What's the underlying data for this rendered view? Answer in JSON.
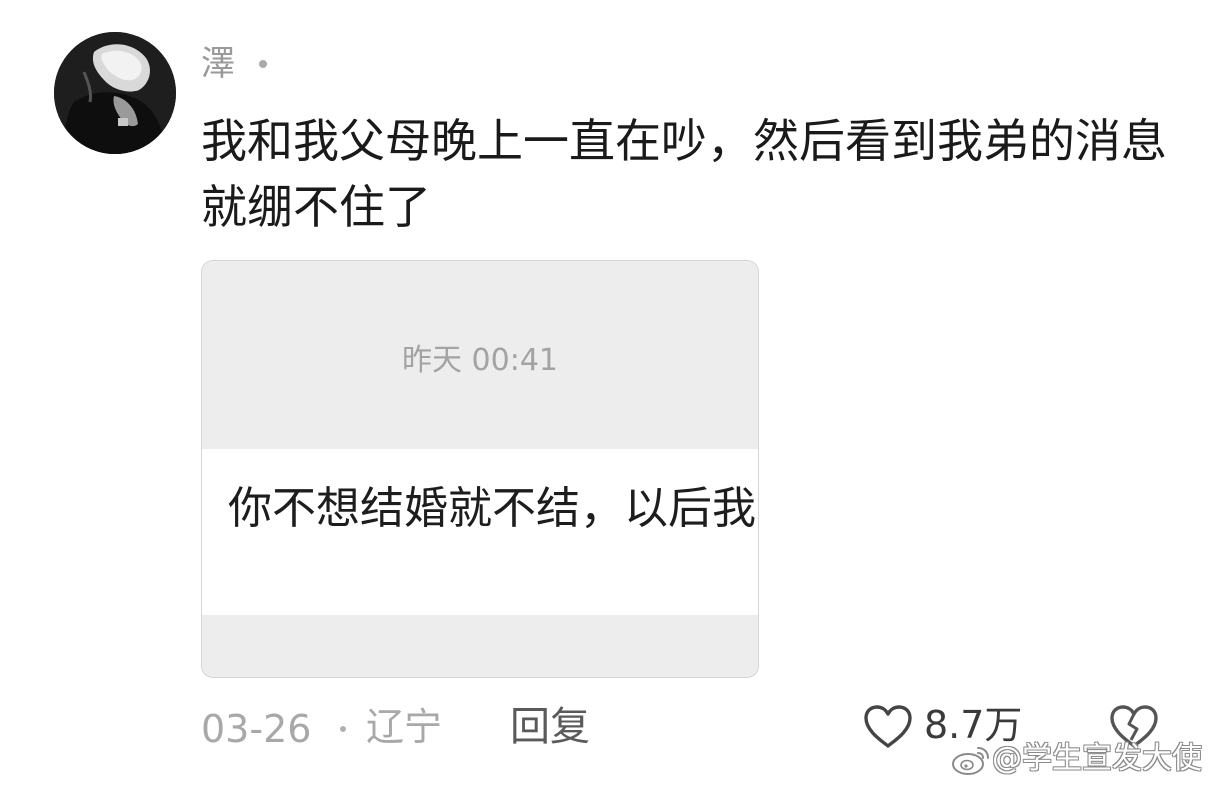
{
  "comment": {
    "username": "澤",
    "text": "我和我父母晚上一直在吵，然后看到我弟的消息就绷不住了",
    "image": {
      "timestamp": "昨天 00:41",
      "message": "你不想结婚就不结，以后我"
    },
    "date": "03-26",
    "location": "辽宁",
    "reply_label": "回复",
    "like_count": "8.7万",
    "icons": {
      "like": "heart-outline-icon",
      "dislike": "broken-heart-outline-icon"
    }
  },
  "watermark": {
    "text": "@学生宣发大使",
    "logo": "weibo-logo-icon"
  }
}
